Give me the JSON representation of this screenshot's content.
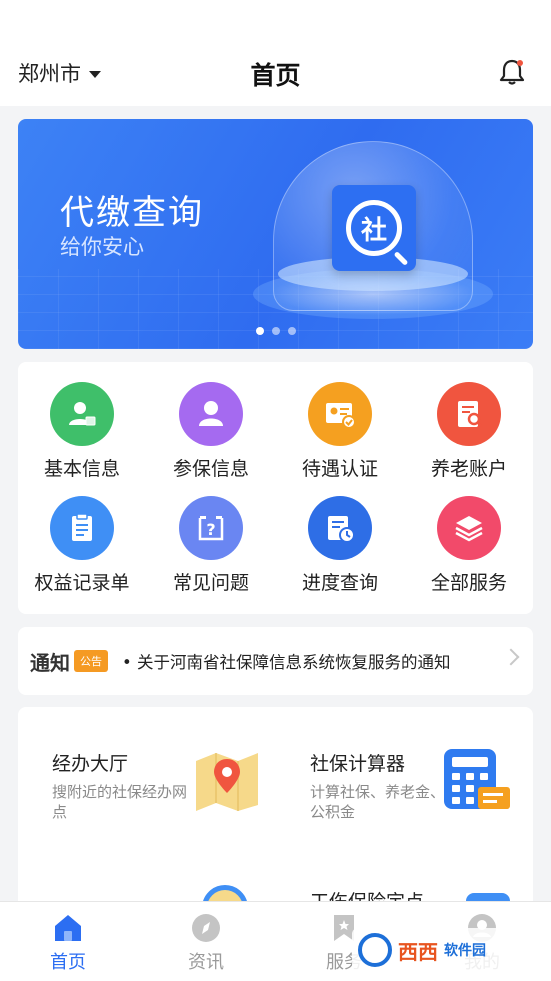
{
  "header": {
    "city": "郑州市",
    "title": "首页"
  },
  "banner": {
    "title": "代缴查询",
    "subtitle": "给你安心",
    "badge_char": "社",
    "dots": 3,
    "active_dot": 0
  },
  "services": [
    {
      "label": "基本信息",
      "icon": "person-card-icon",
      "color": "#3fbf6a"
    },
    {
      "label": "参保信息",
      "icon": "user-icon",
      "color": "#a56af0"
    },
    {
      "label": "待遇认证",
      "icon": "id-card-check-icon",
      "color": "#f5a020"
    },
    {
      "label": "养老账户",
      "icon": "account-search-icon",
      "color": "#f0553f"
    },
    {
      "label": "权益记录单",
      "icon": "clipboard-icon",
      "color": "#3f8ff5"
    },
    {
      "label": "常见问题",
      "icon": "question-icon",
      "color": "#6a86f2"
    },
    {
      "label": "进度查询",
      "icon": "progress-clock-icon",
      "color": "#2e6ee6"
    },
    {
      "label": "全部服务",
      "icon": "layers-icon",
      "color": "#f24a6a"
    }
  ],
  "notice": {
    "title": "通知",
    "tag": "公告",
    "text": "• 关于河南省社保障信息系统恢复服务的通知"
  },
  "features": [
    {
      "title": "经办大厅",
      "desc": "搜附近的社保经办网点",
      "icon": "map-pin-icon"
    },
    {
      "title": "社保计算器",
      "desc": "计算社保、养老金、公积金",
      "icon": "calculator-icon"
    },
    {
      "title": "",
      "desc": "",
      "icon": ""
    },
    {
      "title": "工伤保险定点",
      "desc": "",
      "icon": ""
    }
  ],
  "tabbar": [
    {
      "label": "首页",
      "icon": "home-icon",
      "active": true
    },
    {
      "label": "资讯",
      "icon": "compass-icon",
      "active": false
    },
    {
      "label": "服务",
      "icon": "bookmark-icon",
      "active": false
    },
    {
      "label": "我的",
      "icon": "profile-icon",
      "active": false
    }
  ],
  "watermark": {
    "brand": "西西",
    "sub": "软件园"
  },
  "colors": {
    "accent": "#2c6ef2",
    "notice_tag": "#f59a23"
  }
}
